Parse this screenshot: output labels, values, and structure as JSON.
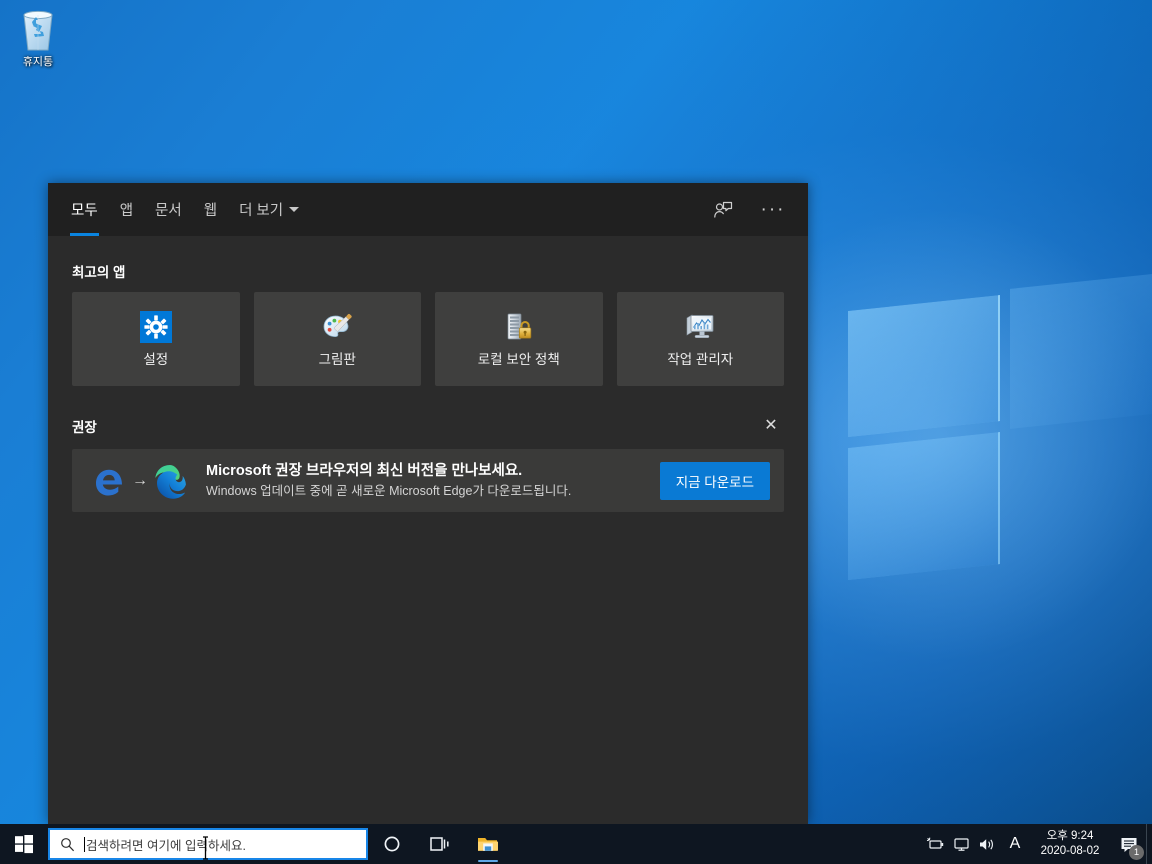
{
  "desktop": {
    "recycle_bin": {
      "label": "휴지통",
      "icon": "recycle-bin-icon"
    }
  },
  "search_panel": {
    "tabs": [
      {
        "label": "모두",
        "active": true
      },
      {
        "label": "앱",
        "active": false
      },
      {
        "label": "문서",
        "active": false
      },
      {
        "label": "웹",
        "active": false
      },
      {
        "label": "더 보기",
        "active": false,
        "has_caret": true
      }
    ],
    "header_actions": [
      {
        "name": "feedback-icon",
        "label": ""
      },
      {
        "name": "more-options-icon",
        "label": "···"
      }
    ],
    "best_apps": {
      "title": "최고의 앱",
      "tiles": [
        {
          "label": "설정",
          "icon": "settings-gear-icon"
        },
        {
          "label": "그림판",
          "icon": "paint-palette-icon"
        },
        {
          "label": "로컬 보안 정책",
          "icon": "security-policy-icon"
        },
        {
          "label": "작업 관리자",
          "icon": "task-manager-icon"
        }
      ]
    },
    "recommendation": {
      "title": "권장",
      "close_label": "✕",
      "card": {
        "heading": "Microsoft 권장 브라우저의 최신 버전을 만나보세요.",
        "subtext": "Windows 업데이트 중에 곧 새로운 Microsoft Edge가 다운로드됩니다.",
        "button_label": "지금 다운로드",
        "icons": [
          "edge-legacy-icon",
          "arrow-right-icon",
          "edge-chromium-icon"
        ]
      }
    }
  },
  "taskbar": {
    "start": {
      "name": "start-button",
      "label": "시작"
    },
    "search": {
      "placeholder": "검색하려면 여기에 입력하세요.",
      "value": "",
      "icon": "search-icon"
    },
    "buttons": [
      {
        "name": "cortana-button",
        "icon": "cortana-circle-icon"
      },
      {
        "name": "task-view-button",
        "icon": "task-view-icon"
      },
      {
        "name": "file-explorer-button",
        "icon": "folder-icon"
      }
    ],
    "tray": {
      "icons": [
        {
          "name": "battery-icon"
        },
        {
          "name": "network-display-icon"
        },
        {
          "name": "volume-icon"
        }
      ],
      "ime": "A",
      "clock": {
        "time": "오후 9:24",
        "date": "2020-08-02"
      },
      "notifications": {
        "icon": "notification-icon",
        "badge_count": "1"
      }
    }
  },
  "colors": {
    "accent_blue": "#0a7ad4",
    "panel_bg": "#2b2b2b",
    "panel_header_bg": "#202020",
    "tile_bg": "#3f3f3e",
    "card_bg": "#3a3a39",
    "taskbar_bg": "#0e1621",
    "tab_active_underline": "#0a84e0"
  }
}
